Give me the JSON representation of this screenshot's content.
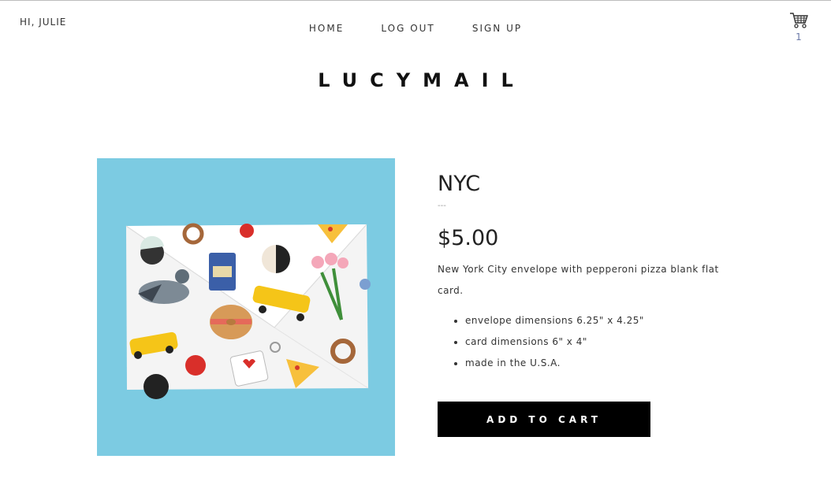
{
  "header": {
    "greeting": "HI, JULIE",
    "nav": [
      "HOME",
      "LOG OUT",
      "SIGN UP"
    ],
    "cart_count": "1"
  },
  "brand": "LUCYMAIL",
  "product": {
    "title": "NYC",
    "divider": "---",
    "price": "$5.00",
    "description": "New York City envelope with pepperoni pizza blank flat card.",
    "features": [
      "envelope dimensions 6.25\" x 4.25\"",
      "card dimensions 6\" x 4\"",
      "made in the U.S.A."
    ],
    "image_description": "Illustrated envelope with NYC icons: pigeon, taxis, bagel, pizza, pretzels, apples, coffee cup, I love NY keychain, flowers, cookies"
  },
  "actions": {
    "add_to_cart": "ADD TO CART"
  },
  "colors": {
    "image_background": "#7ccbe2",
    "button": "#000000",
    "cart_count": "#6b79a8"
  }
}
